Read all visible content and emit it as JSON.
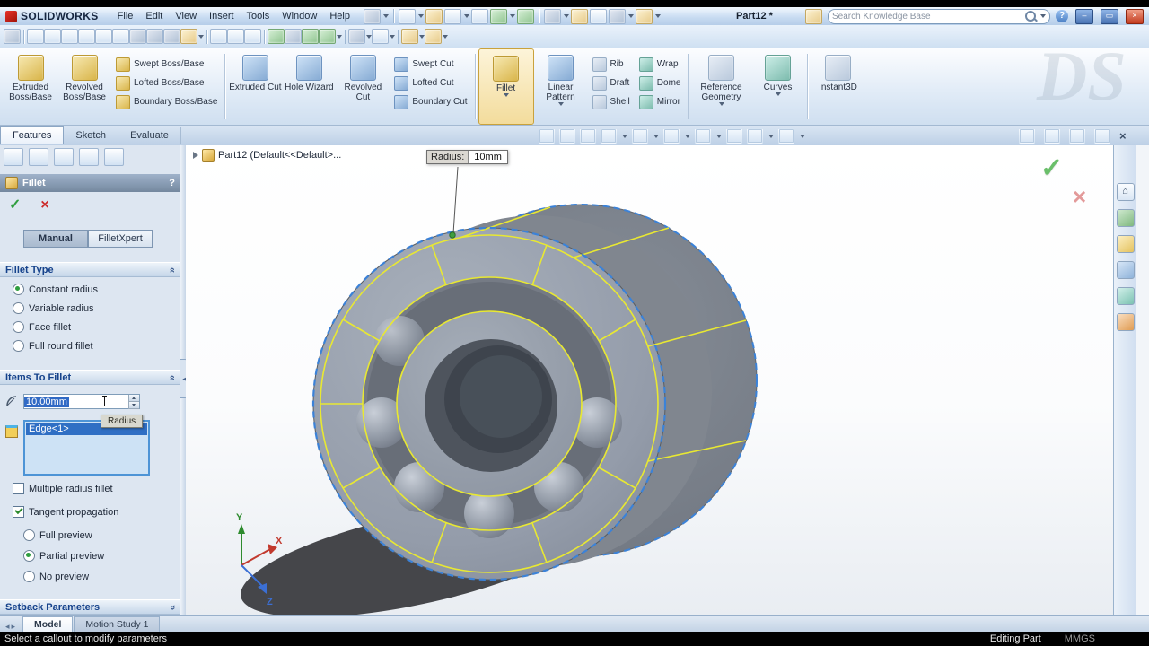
{
  "glyphs": {
    "ok": "✓",
    "cancel": "×",
    "help": "?",
    "home": "⌂",
    "minimize": "–",
    "maximize": "▭",
    "close": "×",
    "chevron_double": "»",
    "left_arrow": "◂",
    "tab_nav": "◂▸"
  },
  "titlebar": {
    "app_name": "SOLIDWORKS",
    "menus": [
      "File",
      "Edit",
      "View",
      "Insert",
      "Tools",
      "Window",
      "Help"
    ],
    "document_title": "Part12 *",
    "search_placeholder": "Search Knowledge Base",
    "help": "?"
  },
  "command_tabs": {
    "tabs": [
      "Features",
      "Sketch",
      "Evaluate"
    ],
    "active": "Features"
  },
  "ribbon": {
    "buttons": [
      {
        "label": "Extruded Boss/Base"
      },
      {
        "label": "Revolved Boss/Base"
      },
      {
        "label": "Swept Boss/Base"
      },
      {
        "label": "Lofted Boss/Base"
      },
      {
        "label": "Boundary Boss/Base"
      },
      {
        "label": "Extruded Cut"
      },
      {
        "label": "Hole Wizard"
      },
      {
        "label": "Revolved Cut"
      },
      {
        "label": "Swept Cut"
      },
      {
        "label": "Lofted Cut"
      },
      {
        "label": "Boundary Cut"
      },
      {
        "label": "Fillet"
      },
      {
        "label": "Linear Pattern"
      },
      {
        "label": "Rib"
      },
      {
        "label": "Draft"
      },
      {
        "label": "Shell"
      },
      {
        "label": "Wrap"
      },
      {
        "label": "Dome"
      },
      {
        "label": "Mirror"
      },
      {
        "label": "Reference Geometry"
      },
      {
        "label": "Curves"
      },
      {
        "label": "Instant3D"
      }
    ]
  },
  "property_manager": {
    "title": "Fillet",
    "help": "?",
    "mode_tabs": [
      "Manual",
      "FilletXpert"
    ],
    "active_mode": "Manual",
    "fillet_type": {
      "header": "Fillet Type",
      "options": [
        "Constant radius",
        "Variable radius",
        "Face fillet",
        "Full round fillet"
      ],
      "selected": "Constant radius"
    },
    "items_to_fillet": {
      "header": "Items To Fillet",
      "radius_value": "10.00mm",
      "radius_tooltip": "Radius",
      "edge_items": [
        "Edge<1>"
      ],
      "multiple_radius_label": "Multiple radius fillet",
      "multiple_radius_checked": false,
      "tangent_label": "Tangent propagation",
      "tangent_checked": true,
      "preview_options": [
        "Full preview",
        "Partial preview",
        "No preview"
      ],
      "preview_selected": "Partial preview"
    },
    "setback": {
      "header": "Setback Parameters"
    }
  },
  "graphics": {
    "feature_tree_label": "Part12 (Default<<Default>...",
    "callout_label": "Radius:",
    "callout_value": "10mm",
    "triad": {
      "x": "X",
      "y": "Y",
      "z": "Z"
    },
    "selected_edge_color": "#3b82d8",
    "preview_edge_color": "#e8e832"
  },
  "taskpane_icons": [
    "solidworks-resources",
    "design-library",
    "file-explorer",
    "search",
    "appearances-scenes",
    "custom-properties"
  ],
  "bottom": {
    "tabs": [
      "Model",
      "Motion Study 1"
    ],
    "active_tab": "Model",
    "status_message": "Select a callout to modify parameters",
    "mode": "Editing Part",
    "units": "MMGS"
  },
  "watermark": "DS"
}
